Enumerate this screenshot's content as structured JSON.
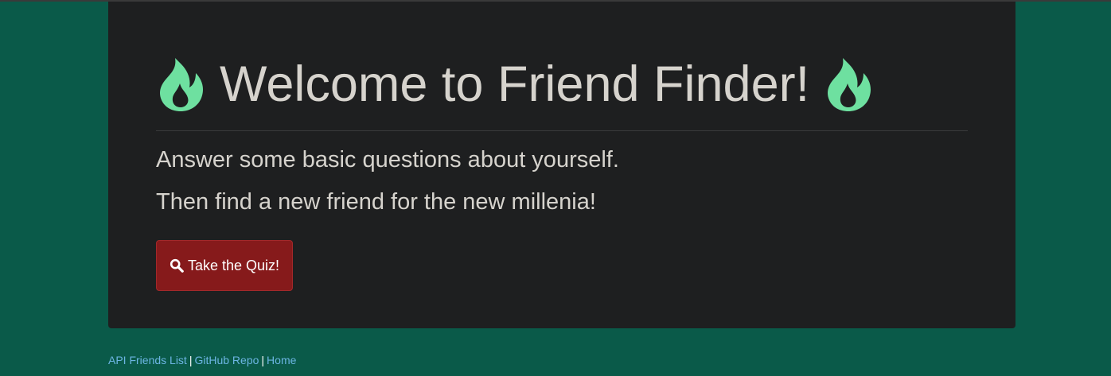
{
  "colors": {
    "page_background": "#0a5a49",
    "panel_background": "#1e1f20",
    "flame": "#6ee0a0",
    "button_background": "#861a1b",
    "link": "#6cb5e3",
    "text": "#d6d3cd"
  },
  "header": {
    "title": "Welcome to Friend Finder!",
    "left_icon": "fire-icon",
    "right_icon": "fire-icon"
  },
  "lead": {
    "line1": "Answer some basic questions about yourself.",
    "line2": "Then find a new friend for the new millenia!"
  },
  "quiz_button": {
    "icon": "search-icon",
    "label": "Take the Quiz!"
  },
  "footer": {
    "links": [
      {
        "label": "API Friends List"
      },
      {
        "label": "GitHub Repo"
      },
      {
        "label": "Home"
      }
    ],
    "separator": "|"
  }
}
